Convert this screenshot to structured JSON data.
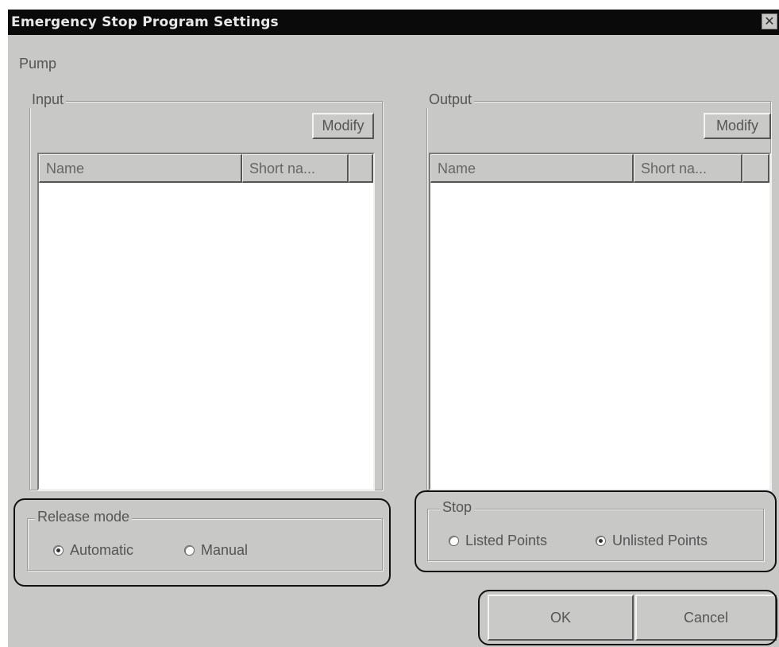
{
  "window": {
    "title": "Emergency Stop Program Settings",
    "close_glyph": "✕"
  },
  "pump_label": "Pump",
  "input_group": {
    "legend": "Input",
    "modify_label": "Modify",
    "columns": [
      "Name",
      "Short na..."
    ]
  },
  "output_group": {
    "legend": "Output",
    "modify_label": "Modify",
    "columns": [
      "Name",
      "Short na..."
    ]
  },
  "release_mode": {
    "legend": "Release mode",
    "options": [
      {
        "label": "Automatic",
        "selected": true
      },
      {
        "label": "Manual",
        "selected": false
      }
    ]
  },
  "stop": {
    "legend": "Stop",
    "options": [
      {
        "label": "Listed Points",
        "selected": false
      },
      {
        "label": "Unlisted Points",
        "selected": true
      }
    ]
  },
  "buttons": {
    "ok_label": "OK",
    "cancel_label": "Cancel"
  }
}
